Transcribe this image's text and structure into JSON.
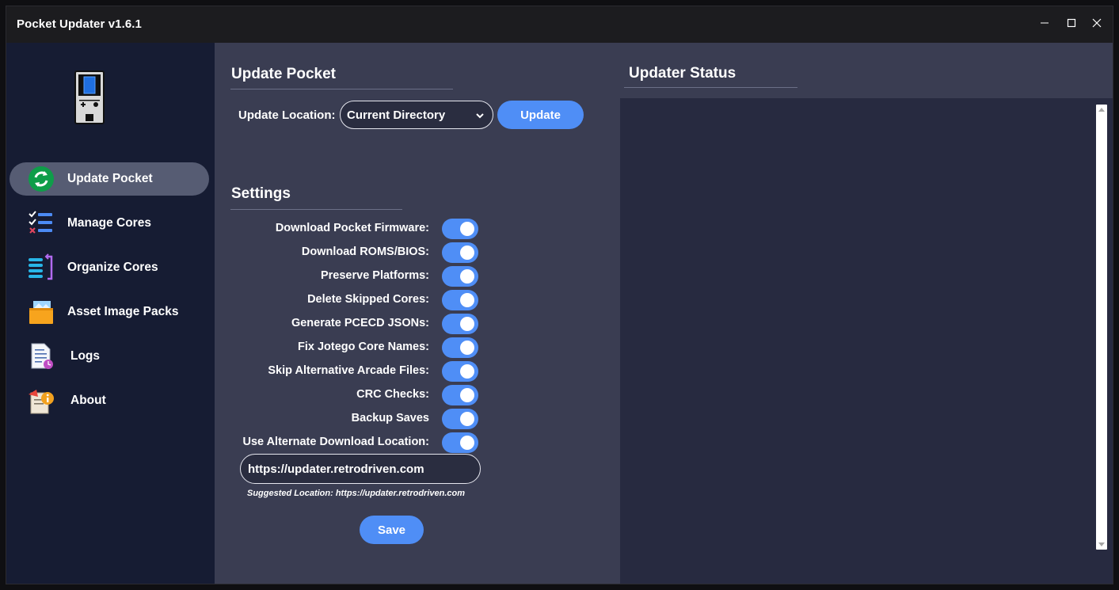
{
  "window": {
    "title": "Pocket Updater v1.6.1",
    "controls": [
      "minimize-icon",
      "maximize-icon",
      "close-icon"
    ]
  },
  "sidebar": {
    "logo_icon": "pocket-handheld-icon",
    "items": [
      {
        "label": "Update Pocket",
        "icon": "refresh-icon",
        "active": true
      },
      {
        "label": "Manage Cores",
        "icon": "checklist-icon",
        "active": false
      },
      {
        "label": "Organize Cores",
        "icon": "sort-list-icon",
        "active": false
      },
      {
        "label": "Asset Image Packs",
        "icon": "image-box-icon",
        "active": false
      },
      {
        "label": "Logs",
        "icon": "log-document-icon",
        "active": false
      },
      {
        "label": "About",
        "icon": "info-icon",
        "active": false
      }
    ]
  },
  "update_section": {
    "title": "Update Pocket",
    "location_label": "Update Location:",
    "location_value": "Current Directory",
    "update_button": "Update"
  },
  "settings": {
    "title": "Settings",
    "items": [
      {
        "label": "Download Pocket Firmware:",
        "enabled": true
      },
      {
        "label": "Download ROMS/BIOS:",
        "enabled": true
      },
      {
        "label": "Preserve Platforms:",
        "enabled": true
      },
      {
        "label": "Delete Skipped Cores:",
        "enabled": true
      },
      {
        "label": "Generate PCECD JSONs:",
        "enabled": true
      },
      {
        "label": "Fix Jotego Core Names:",
        "enabled": true
      },
      {
        "label": "Skip Alternative Arcade Files:",
        "enabled": true
      },
      {
        "label": "CRC Checks:",
        "enabled": true
      },
      {
        "label": "Backup Saves",
        "enabled": true
      },
      {
        "label": "Use Alternate Download Location:",
        "enabled": true
      }
    ],
    "alternate_url": "https://updater.retrodriven.com",
    "suggested_text": "Suggested Location: https://updater.retrodriven.com",
    "save_button": "Save"
  },
  "status": {
    "title": "Updater Status",
    "content": ""
  },
  "colors": {
    "accent": "#4f8ef6",
    "sidebar_bg": "#161c33",
    "main_bg": "#3a3d52",
    "status_bg": "#272a40",
    "active_nav": "#565c73"
  }
}
